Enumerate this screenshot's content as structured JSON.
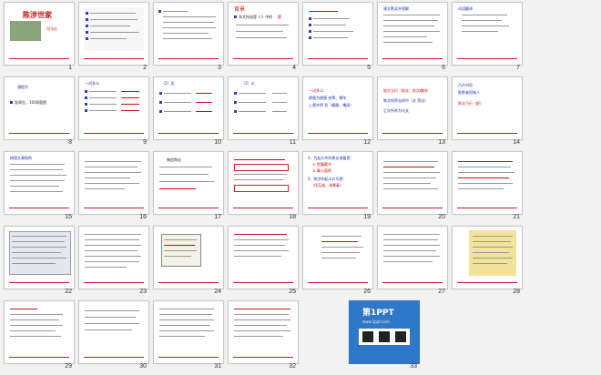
{
  "slides": [
    {
      "n": "1",
      "title": "陈涉世家",
      "sub": "司马迁"
    },
    {
      "n": "2"
    },
    {
      "n": "3"
    },
    {
      "n": "4",
      "head": "背景",
      "line": "本文所选是《 》中的",
      "blank": "题"
    },
    {
      "n": "5"
    },
    {
      "n": "6",
      "head": "课文默读并理解"
    },
    {
      "n": "7",
      "head": "词语翻译"
    },
    {
      "n": "8",
      "head": "通假字",
      "text": "发闾左，100闾国民"
    },
    {
      "n": "9",
      "head": "一词多义"
    },
    {
      "n": "10",
      "head": "（2）而"
    },
    {
      "n": "11",
      "head": "（3）以"
    },
    {
      "n": "12",
      "l1": "一词多义：",
      "l2": "便殖为便殖 央策、揭竿",
      "l3": "上便并得 吞（喔喔、播阔）"
    },
    {
      "n": "13",
      "l1": "皆次当行（陷次，依次编排）",
      "l2": "陈次所旁丛祠中（次 旁边）",
      "l3": "之次所杀为屯长"
    },
    {
      "n": "14",
      "l1": "乃丹书帛",
      "l2": "陈胜者阳城人",
      "l3": "陈次乃行（赶）"
    },
    {
      "n": "15",
      "head": "梳理文章结构"
    },
    {
      "n": "16"
    },
    {
      "n": "17",
      "head": "制造舆论"
    },
    {
      "n": "18"
    },
    {
      "n": "19",
      "l1": "3、为起义作的舆论准备是：",
      "l2": "① 鱼腹藏书",
      "l3": "② 篝火狐鸣",
      "l4": "4、陈涉的起义口号是：",
      "l5": "（伐无道，诛暴秦）"
    },
    {
      "n": "20"
    },
    {
      "n": "21"
    },
    {
      "n": "22"
    },
    {
      "n": "23"
    },
    {
      "n": "24"
    },
    {
      "n": "25"
    },
    {
      "n": "26"
    },
    {
      "n": "27"
    },
    {
      "n": "28"
    },
    {
      "n": "29"
    },
    {
      "n": "30"
    },
    {
      "n": "31"
    },
    {
      "n": "32"
    },
    {
      "n": "33",
      "brand": "第1PPT",
      "site": "www.1ppt.com"
    }
  ]
}
